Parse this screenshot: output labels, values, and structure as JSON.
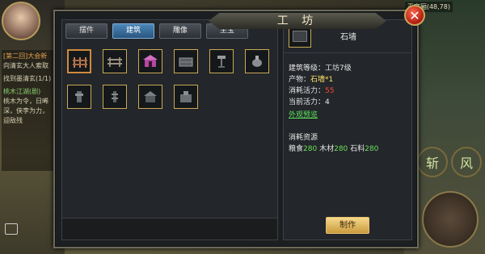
{
  "window": {
    "title": "工 坊"
  },
  "tabs": [
    {
      "label": "摆件",
      "active": false
    },
    {
      "label": "建筑",
      "active": true
    },
    {
      "label": "雕像",
      "active": false
    },
    {
      "label": "至宝",
      "active": false
    }
  ],
  "items": [
    {
      "name": "fence-1",
      "icon": "fence-icon",
      "selected": true
    },
    {
      "name": "fence-2",
      "icon": "fence-icon",
      "selected": false
    },
    {
      "name": "shrine",
      "icon": "shrine-icon",
      "selected": false
    },
    {
      "name": "stone-wall",
      "icon": "stone-wall-icon",
      "selected": false
    },
    {
      "name": "lamp",
      "icon": "lamp-icon",
      "selected": false
    },
    {
      "name": "censer",
      "icon": "censer-icon",
      "selected": false
    },
    {
      "name": "stone-lantern",
      "icon": "lantern-icon",
      "selected": false
    },
    {
      "name": "pagoda",
      "icon": "pagoda-icon",
      "selected": false
    },
    {
      "name": "pavilion",
      "icon": "pavilion-icon",
      "selected": false
    },
    {
      "name": "tower",
      "icon": "tower-icon",
      "selected": false
    }
  ],
  "detail": {
    "name": "石墙",
    "level_label": "建筑等级：",
    "level_value": "工坊7级",
    "product_label": "产物：",
    "product_value": "石墙*1",
    "cost_label": "消耗活力：",
    "cost_value": "55",
    "current_label": "当前活力：",
    "current_value": "4",
    "preview_link": "外观预览",
    "resource_title": "消耗资源",
    "resources": [
      {
        "label": "粮食",
        "value": "280"
      },
      {
        "label": "木材",
        "value": "280"
      },
      {
        "label": "石料",
        "value": "280"
      }
    ],
    "make_button": "制作"
  },
  "hud": {
    "map_label": "王宅厢(48,78)",
    "chat": [
      "[第二回]大会新",
      "向清玄大人索取",
      "找到墨清玄(1/1)",
      "桃木江湖(剧)",
      "桃木为令，日晞",
      "深，侠李为力，",
      "迎敌残"
    ],
    "skill_1": "斩",
    "skill_2": "风"
  },
  "colors": {
    "accent_tab": "#4c86b8",
    "warning": "#ff4a3a",
    "highlight": "#ffe46a",
    "resource_value": "#6be05a",
    "make_button": "#f6d88a"
  }
}
